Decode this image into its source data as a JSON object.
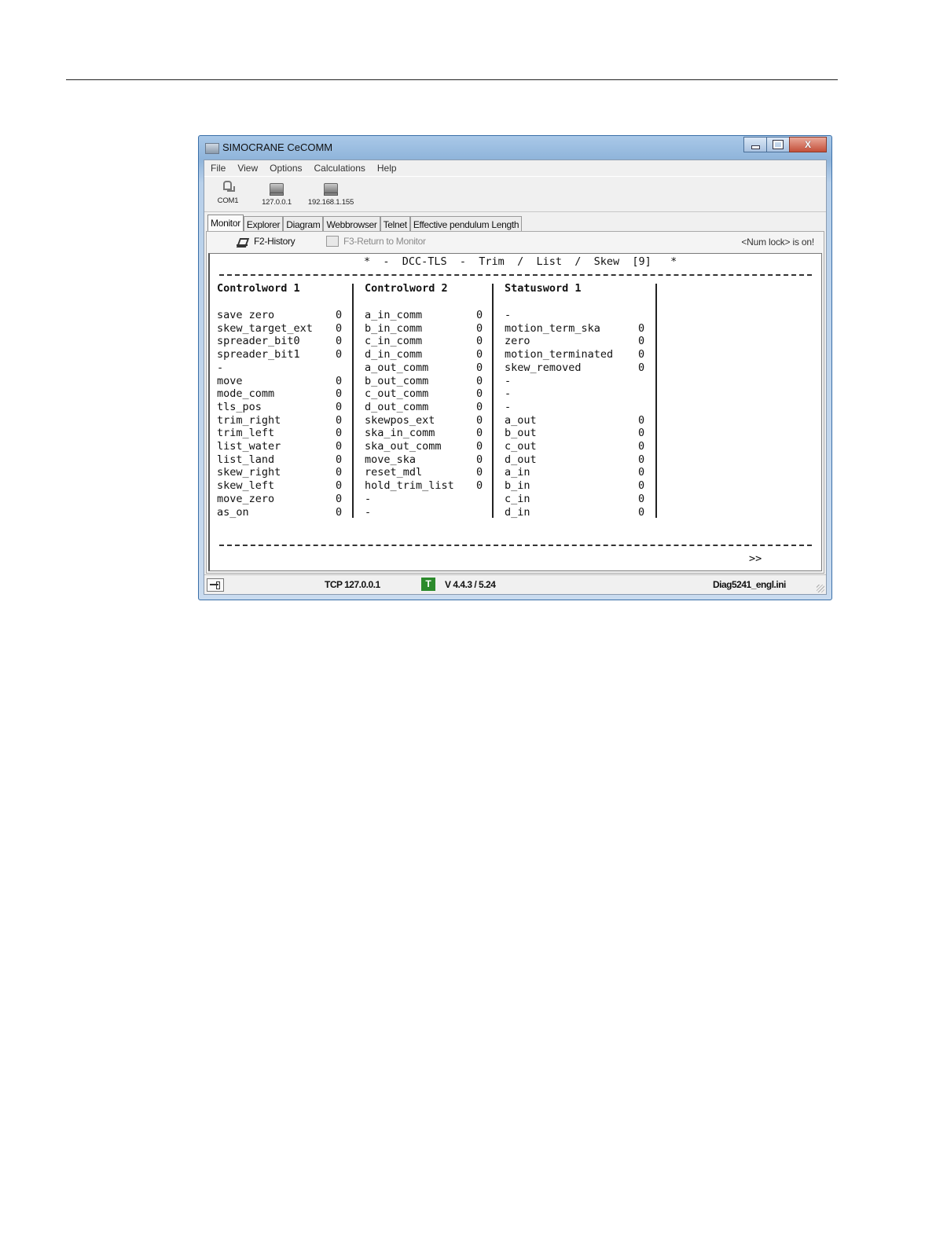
{
  "window": {
    "title": "SIMOCRANE CeCOMM",
    "controls": {
      "minimize": "—",
      "maximize": "□",
      "close": "X"
    }
  },
  "menu": [
    "File",
    "View",
    "Options",
    "Calculations",
    "Help"
  ],
  "toolbar": [
    {
      "label": "COM1",
      "icon": "serial-port-icon"
    },
    {
      "label": "127.0.0.1",
      "icon": "network-pc-icon"
    },
    {
      "label": "192.168.1.155",
      "icon": "network-pc-icon"
    }
  ],
  "tabs": [
    "Monitor",
    "Explorer",
    "Diagram",
    "Webbrowser",
    "Telnet",
    "Effective pendulum Length"
  ],
  "active_tab": "Monitor",
  "subbar": {
    "history": "F2-History",
    "return": "F3-Return to Monitor",
    "numlock": "<Num lock> is on!"
  },
  "terminal": {
    "title": "*  -  DCC-TLS  -  Trim  /  List  /  Skew  [9]   *",
    "headers": [
      "Controlword 1",
      "Controlword 2",
      "Statusword 1"
    ],
    "rows": [
      {
        "c1": "save zero",
        "v1": "0",
        "c2": "a_in_comm",
        "v2": "0",
        "c3": "-",
        "v3": ""
      },
      {
        "c1": "skew_target_ext",
        "v1": "0",
        "c2": "b_in_comm",
        "v2": "0",
        "c3": "motion_term_ska",
        "v3": "0"
      },
      {
        "c1": "spreader_bit0",
        "v1": "0",
        "c2": "c_in_comm",
        "v2": "0",
        "c3": "zero",
        "v3": "0"
      },
      {
        "c1": "spreader_bit1",
        "v1": "0",
        "c2": "d_in_comm",
        "v2": "0",
        "c3": "motion_terminated",
        "v3": "0"
      },
      {
        "c1": "-",
        "v1": "",
        "c2": "a_out_comm",
        "v2": "0",
        "c3": "skew_removed",
        "v3": "0"
      },
      {
        "c1": "move",
        "v1": "0",
        "c2": "b_out_comm",
        "v2": "0",
        "c3": "-",
        "v3": ""
      },
      {
        "c1": "mode_comm",
        "v1": "0",
        "c2": "c_out_comm",
        "v2": "0",
        "c3": "-",
        "v3": ""
      },
      {
        "c1": "tls_pos",
        "v1": "0",
        "c2": "d_out_comm",
        "v2": "0",
        "c3": "-",
        "v3": ""
      },
      {
        "c1": "trim_right",
        "v1": "0",
        "c2": "skewpos_ext",
        "v2": "0",
        "c3": "a_out",
        "v3": "0"
      },
      {
        "c1": "trim_left",
        "v1": "0",
        "c2": "ska_in_comm",
        "v2": "0",
        "c3": "b_out",
        "v3": "0"
      },
      {
        "c1": "list_water",
        "v1": "0",
        "c2": "ska_out_comm",
        "v2": "0",
        "c3": "c_out",
        "v3": "0"
      },
      {
        "c1": "list_land",
        "v1": "0",
        "c2": "move_ska",
        "v2": "0",
        "c3": "d_out",
        "v3": "0"
      },
      {
        "c1": "skew_right",
        "v1": "0",
        "c2": "reset_mdl",
        "v2": "0",
        "c3": "a_in",
        "v3": "0"
      },
      {
        "c1": "skew_left",
        "v1": "0",
        "c2": "hold_trim_list",
        "v2": "0",
        "c3": "b_in",
        "v3": "0"
      },
      {
        "c1": "move_zero",
        "v1": "0",
        "c2": "-",
        "v2": "",
        "c3": "c_in",
        "v3": "0"
      },
      {
        "c1": "as_on",
        "v1": "0",
        "c2": "-",
        "v2": "",
        "c3": "d_in",
        "v3": "0"
      }
    ],
    "next": ">>"
  },
  "status": {
    "connection": "TCP 127.0.0.1",
    "mode_badge": "T",
    "mode_badge_color": "#2c8a2c",
    "version": "V 4.4.3 / 5.24",
    "ini_file": "Diag5241_engl.ini"
  }
}
